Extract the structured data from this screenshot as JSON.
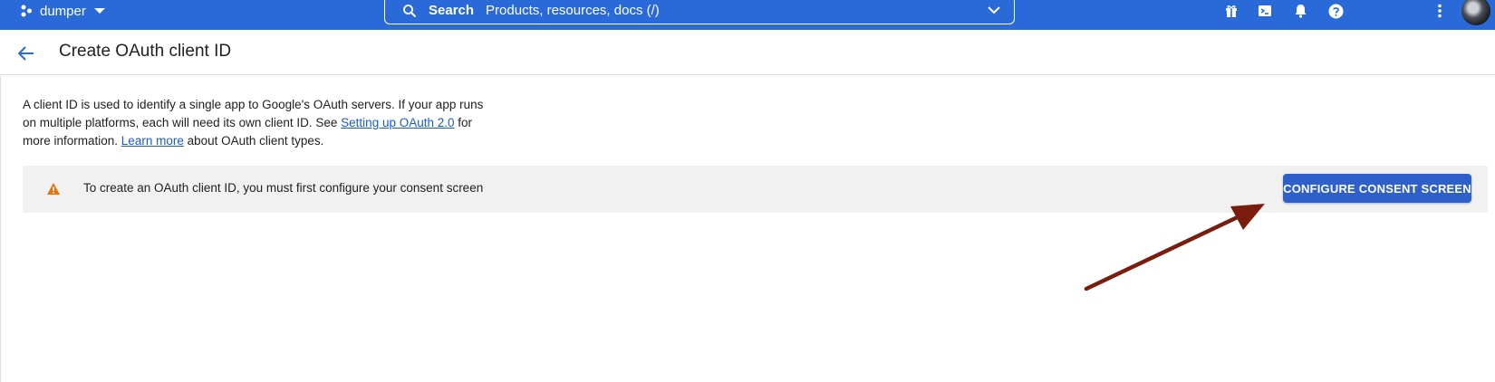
{
  "topbar": {
    "project_name": "dumper",
    "search_label": "Search",
    "search_placeholder": "Products, resources, docs (/)",
    "icons": [
      "gift-icon",
      "cloud-shell-icon",
      "notifications-icon",
      "help-icon",
      "more-vert-icon"
    ],
    "background_color": "#2a6ad8"
  },
  "header": {
    "title": "Create OAuth client ID"
  },
  "description": {
    "text_1": "A client ID is used to identify a single app to Google's OAuth servers. If your app runs on multiple platforms, each will need its own client ID. See ",
    "link_1": "Setting up OAuth 2.0",
    "text_2": " for more information. ",
    "link_2": "Learn more",
    "text_3": " about OAuth client types."
  },
  "banner": {
    "message": "To create an OAuth client ID, you must first configure your consent screen",
    "button_label": "CONFIGURE CONSENT SCREEN",
    "warning_color": "#e8710a",
    "button_color": "#2f5fc9"
  },
  "annotation": {
    "arrow_color": "#7a1d0e"
  }
}
